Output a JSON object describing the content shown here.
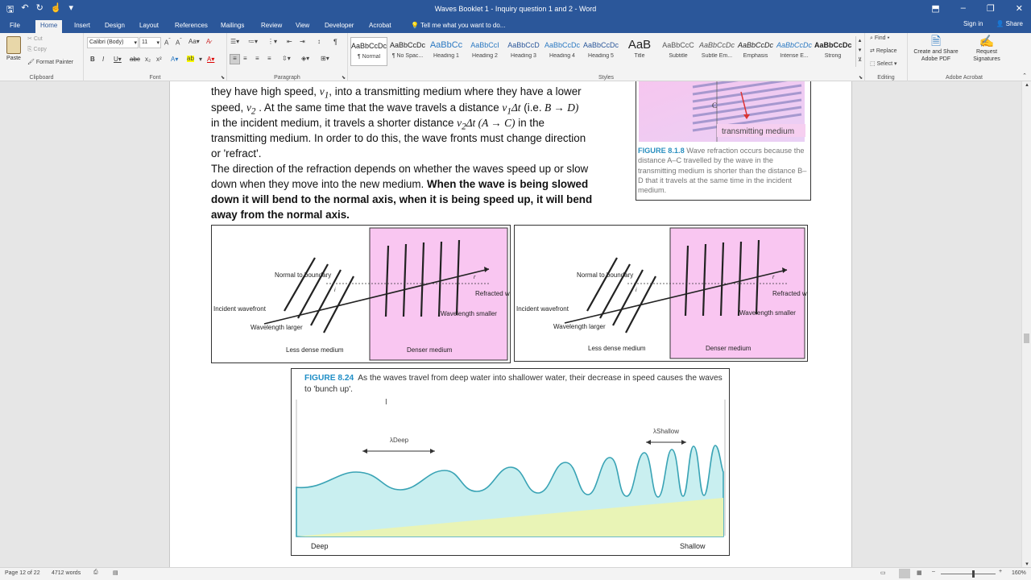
{
  "window": {
    "title": "Waves Booklet 1 - Inquiry question 1 and 2 - Word"
  },
  "tabs": [
    "File",
    "Home",
    "Insert",
    "Design",
    "Layout",
    "References",
    "Mailings",
    "Review",
    "View",
    "Developer",
    "Acrobat"
  ],
  "tell_me": "Tell me what you want to do...",
  "account": {
    "signin": "Sign in",
    "share": "Share"
  },
  "clipboard": {
    "paste": "Paste",
    "cut": "Cut",
    "copy": "Copy",
    "format_painter": "Format Painter",
    "label": "Clipboard"
  },
  "font": {
    "name": "Calibri (Body)",
    "size": "11",
    "label": "Font"
  },
  "paragraph": {
    "label": "Paragraph"
  },
  "styles": {
    "label": "Styles",
    "items": [
      {
        "sample": "AaBbCcDc",
        "name": "¶ Normal"
      },
      {
        "sample": "AaBbCcDc",
        "name": "¶ No Spac..."
      },
      {
        "sample": "AaBbCc",
        "name": "Heading 1"
      },
      {
        "sample": "AaBbCcI",
        "name": "Heading 2"
      },
      {
        "sample": "AaBbCcD",
        "name": "Heading 3"
      },
      {
        "sample": "AaBbCcDc",
        "name": "Heading 4"
      },
      {
        "sample": "AaBbCcDc",
        "name": "Heading 5"
      },
      {
        "sample": "AaB",
        "name": "Title"
      },
      {
        "sample": "AaBbCcC",
        "name": "Subtitle"
      },
      {
        "sample": "AaBbCcDc",
        "name": "Subtle Em..."
      },
      {
        "sample": "AaBbCcDc",
        "name": "Emphasis"
      },
      {
        "sample": "AaBbCcDc",
        "name": "Intense E..."
      },
      {
        "sample": "AaBbCcDc",
        "name": "Strong"
      }
    ]
  },
  "editing": {
    "find": "Find",
    "replace": "Replace",
    "select": "Select",
    "label": "Editing"
  },
  "acrobat": {
    "create": "Create and Share Adobe PDF",
    "request": "Request Signatures",
    "label": "Adobe Acrobat"
  },
  "body": {
    "l1a": "they have high speed,",
    "l1b": ", into a transmitting medium where they have a lower",
    "l2a": "speed,",
    "l2b": ". At the same time that the wave travels a distance",
    "l2c": "(i.e.",
    "l3a": "in the incident medium, it travels a shorter distance",
    "l3b": "in the",
    "l4": "transmitting medium. In order to do this, the wave fronts must change direction",
    "l5": "or 'refract'.",
    "l6": "The direction of the refraction depends on whether the waves speed up or slow",
    "l7a": "down when they move into the new medium.",
    "l7b": "When the wave is being slowed",
    "l8": "down it will bend to the normal axis, when it is being speed up, it will bend",
    "l9": "away from the normal axis."
  },
  "fig818": {
    "medium": "transmitting medium",
    "caption_label": "FIGURE 8.1.8",
    "caption": "Wave refraction occurs because the distance A–C travelled by the wave in the transmitting medium is shorter than the distance B–D that it travels at the same time in the incident medium.",
    "letters": {
      "a": "C"
    }
  },
  "refraction_fig": {
    "normal": "Normal to boundary",
    "incident": "Incident wavefront",
    "wavelength_larger": "Wavelength larger",
    "less_dense": "Less dense medium",
    "denser": "Denser medium",
    "wavelength_smaller": "Wavelength smaller",
    "refracted": "Refracted wavefront",
    "i": "i",
    "r": "r"
  },
  "fig824": {
    "label": "FIGURE 8.24",
    "caption": "As the waves travel from deep water into shallower water, their decrease in speed causes the waves to 'bunch up'.",
    "deep_lambda": "λDeep",
    "shallow_lambda": "λShallow",
    "deep": "Deep",
    "shallow": "Shallow"
  },
  "status": {
    "page": "Page 12 of 22",
    "words": "4712 words",
    "zoom": "160%"
  },
  "colors": {
    "accent": "#2b579a",
    "pink": "#f9c6f1",
    "water": "#c9eff0",
    "sand": "#e9f4b6",
    "fig_label": "#1f8ec6"
  }
}
